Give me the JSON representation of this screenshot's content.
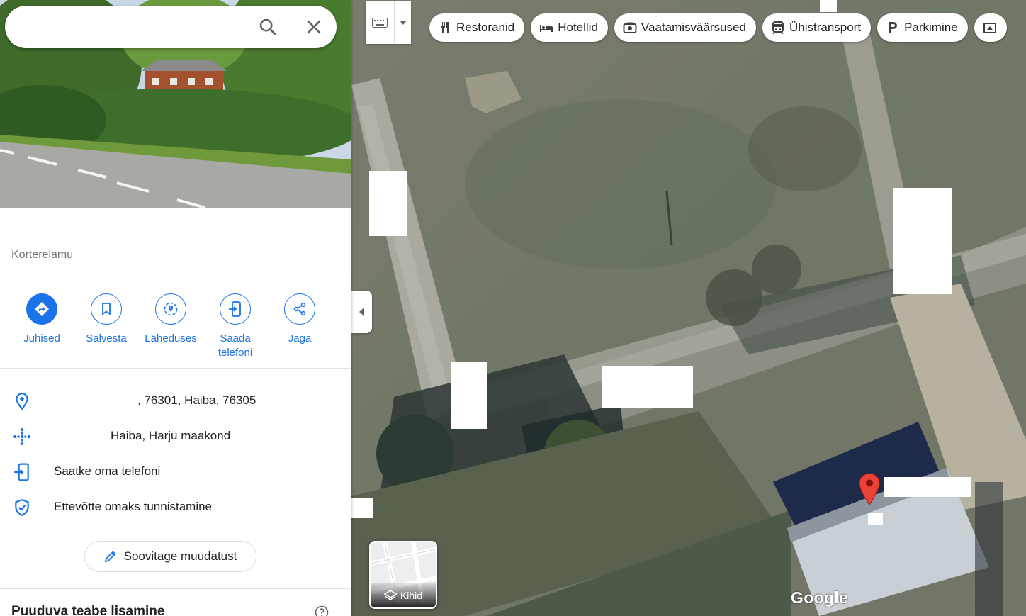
{
  "search": {
    "value": "",
    "placeholder": ""
  },
  "place": {
    "category": "Korterelamu"
  },
  "actions": [
    {
      "label": "Juhised",
      "icon": "directions-icon"
    },
    {
      "label": "Salvesta",
      "icon": "bookmark-icon"
    },
    {
      "label": "Läheduses",
      "icon": "nearby-icon"
    },
    {
      "label_line1": "Saada",
      "label_line2": "telefoni",
      "icon": "send-to-phone-icon"
    },
    {
      "label": "Jaga",
      "icon": "share-icon"
    }
  ],
  "info": {
    "address": ", 76301, Haiba, 76305",
    "plus_code": "Haiba, Harju maakond",
    "send_to_phone": "Saatke oma telefoni",
    "claim_business": "Ettevõtte omaks tunnistamine"
  },
  "suggest_edit": "Soovitage muudatust",
  "missing_info_heading": "Puuduva teabe lisamine",
  "map": {
    "chips": [
      {
        "label": "Restoranid",
        "icon": "restaurant-icon"
      },
      {
        "label": "Hotellid",
        "icon": "hotel-icon"
      },
      {
        "label": "Vaatamisväärsused",
        "icon": "camera-icon"
      },
      {
        "label": "Ühistransport",
        "icon": "transit-icon"
      },
      {
        "label": "Parkimine",
        "icon": "parking-icon"
      }
    ],
    "layers_label": "Kihid",
    "logo": "Google",
    "accent": "#1a73e8",
    "pin_color": "#ea4335"
  }
}
